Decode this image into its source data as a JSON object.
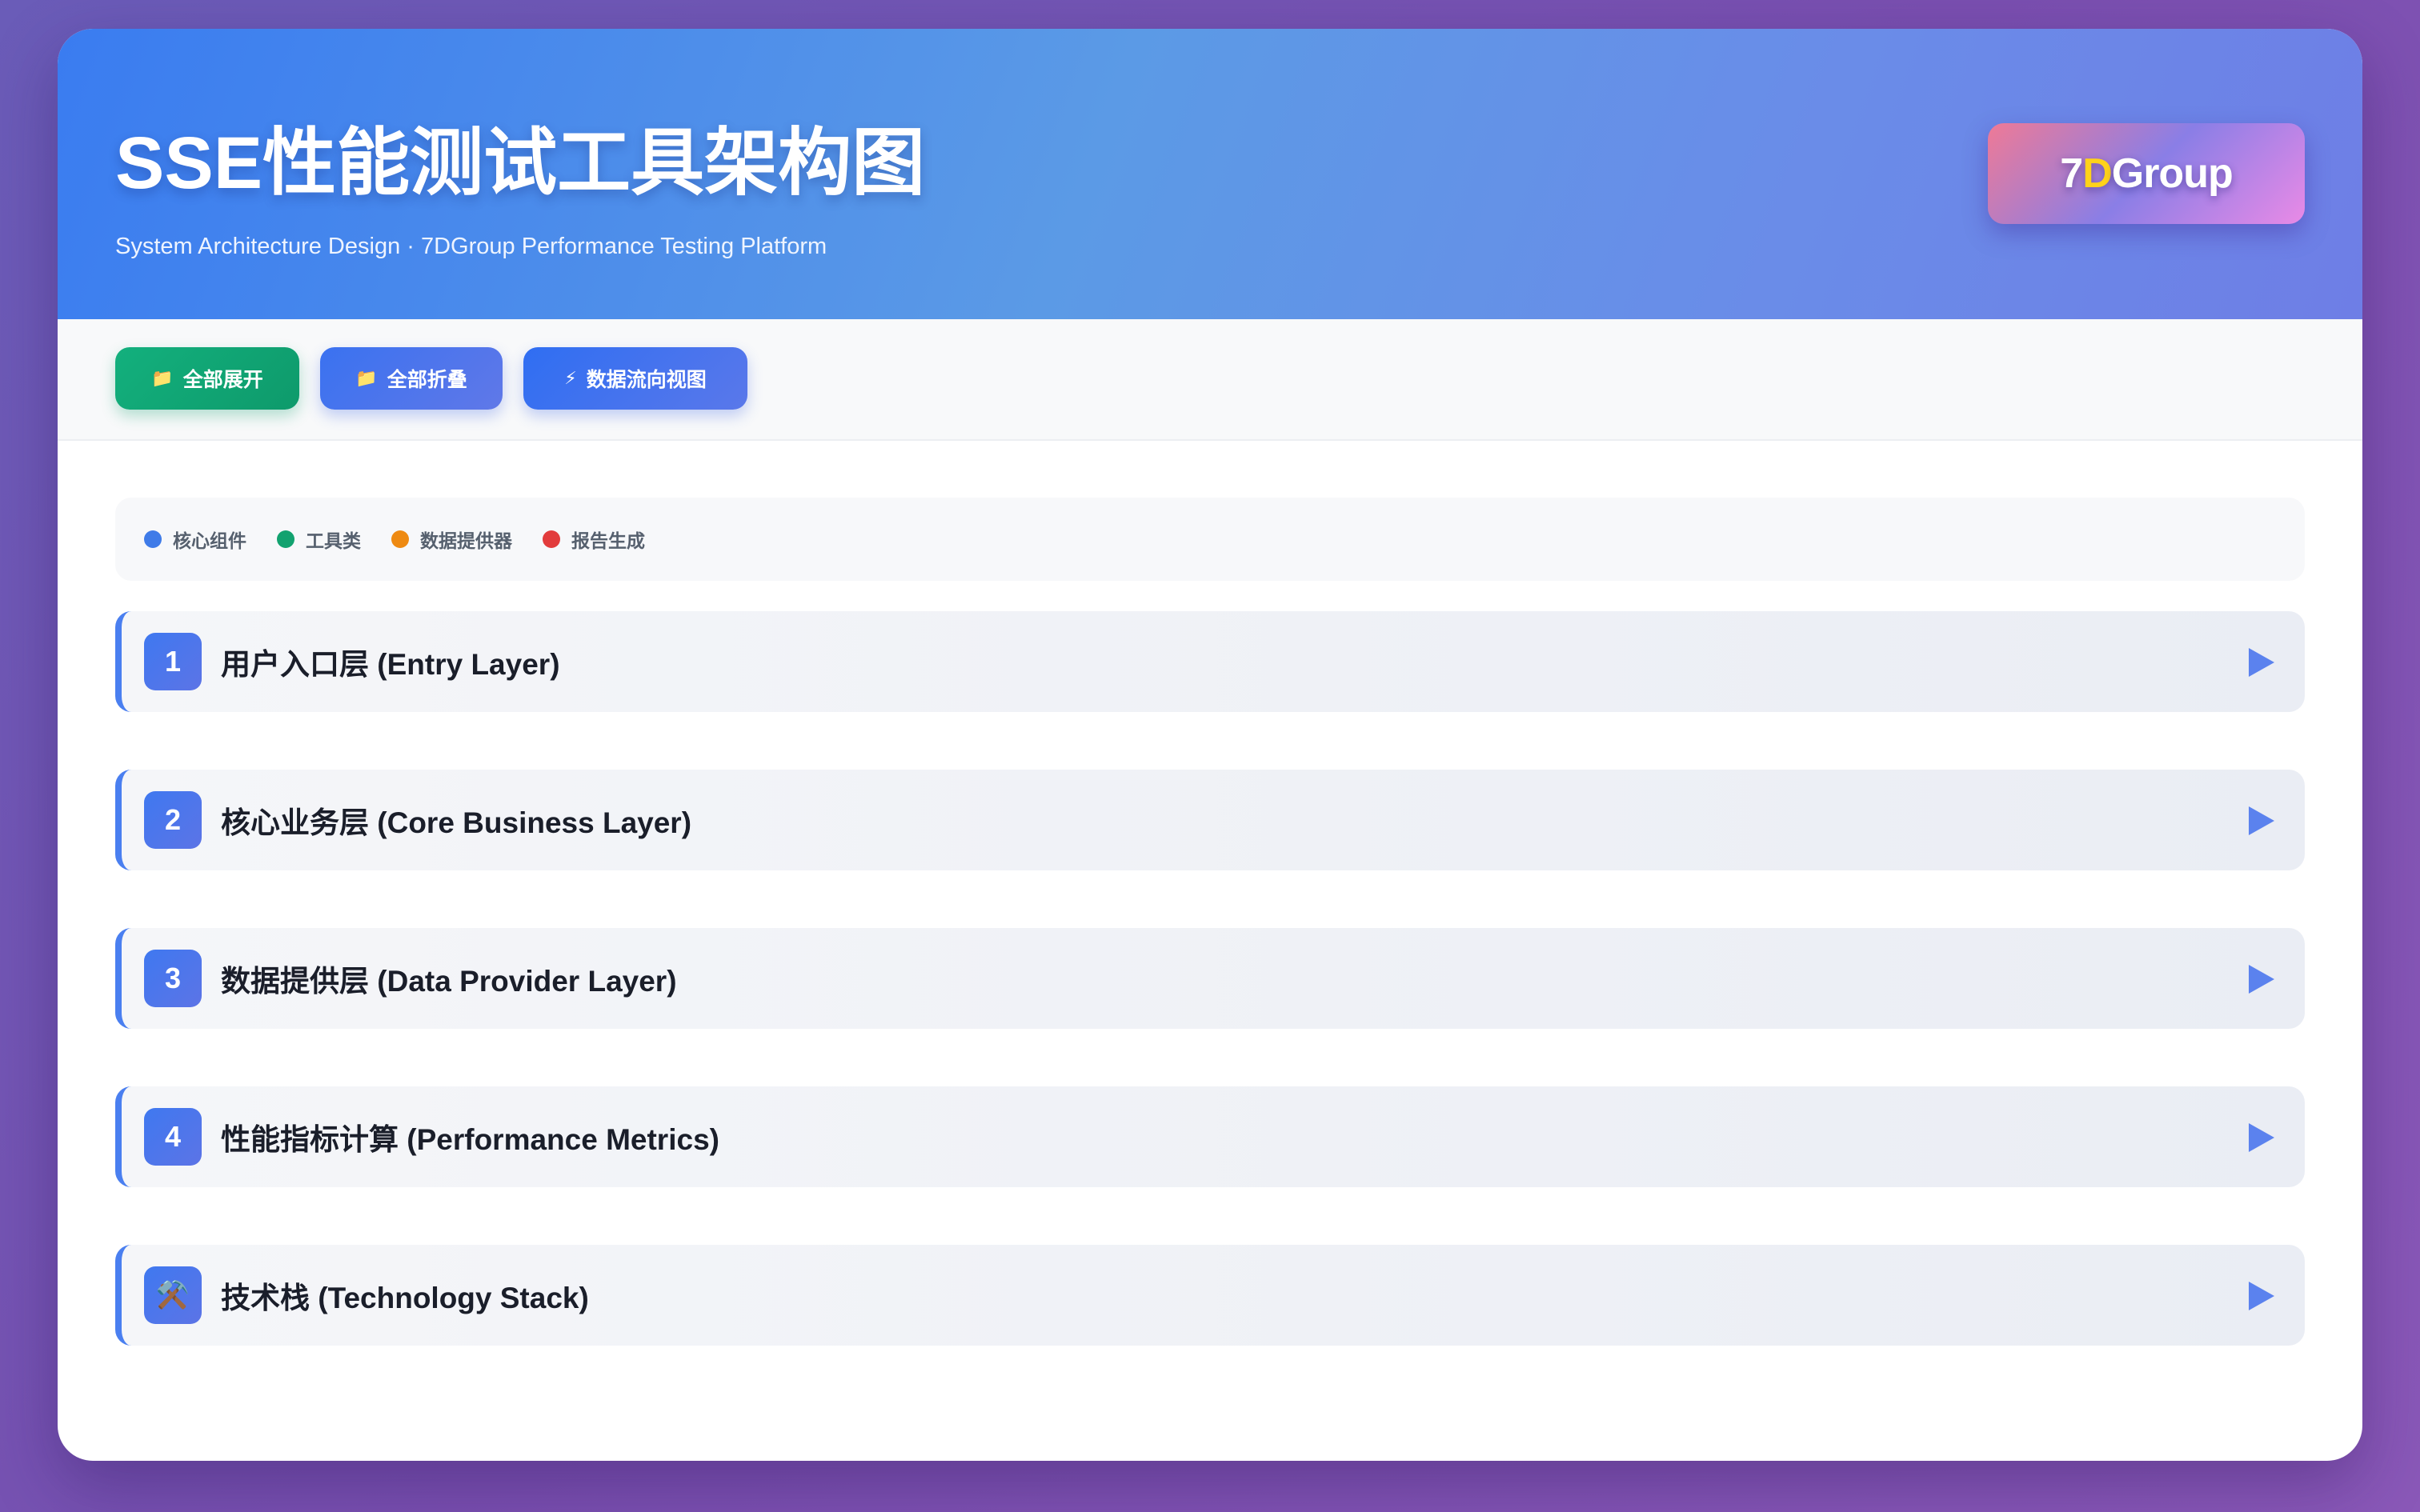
{
  "header": {
    "title": "SSE性能测试工具架构图",
    "subtitle": "System Architecture Design · 7DGroup Performance Testing Platform",
    "brand_a": "7",
    "brand_b": "D",
    "brand_c": "Group"
  },
  "toolbar": {
    "expand_icon": "📁",
    "expand_label": "全部展开",
    "collapse_icon": "📁",
    "collapse_label": "全部折叠",
    "flow_icon": "⚡",
    "flow_label": "数据流向视图"
  },
  "legend": {
    "items": [
      {
        "label": "核心组件",
        "color": "#3f7be8"
      },
      {
        "label": "工具类",
        "color": "#12a26f"
      },
      {
        "label": "数据提供器",
        "color": "#ee8a12"
      },
      {
        "label": "报告生成",
        "color": "#e23c3c"
      }
    ]
  },
  "sections": [
    {
      "badge": "1",
      "title": "用户入口层 (Entry Layer)"
    },
    {
      "badge": "2",
      "title": "核心业务层 (Core Business Layer)"
    },
    {
      "badge": "3",
      "title": "数据提供层 (Data Provider Layer)"
    },
    {
      "badge": "4",
      "title": "性能指标计算 (Performance Metrics)"
    },
    {
      "badge": "⚒️",
      "title": "技术栈 (Technology Stack)"
    }
  ],
  "icons": {
    "section_toggle": "play-arrow-icon",
    "tech_badge": "hammer-wrench-icon"
  }
}
